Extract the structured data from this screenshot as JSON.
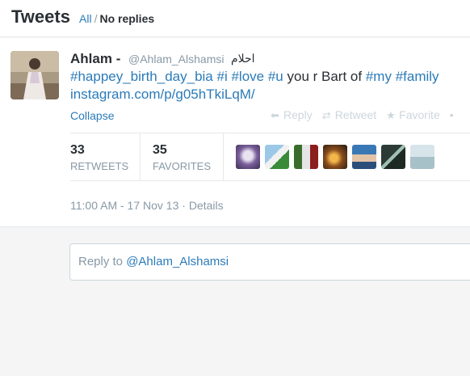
{
  "header": {
    "title": "Tweets",
    "filter_all": "All",
    "separator": "/",
    "filter_active": "No replies"
  },
  "tweet": {
    "name": "Ahlam",
    "name_dash": "-",
    "handle": "@Ahlam_Alshamsi",
    "arabic_name": "احلام",
    "text": {
      "tag1": "#happey_birth_day_bia",
      "tag2": "#i",
      "tag3": "#love",
      "tag4": "#u",
      "plain1": "you r Bart of",
      "tag5": "#my",
      "tag6": "#family",
      "link": "instagram.com/p/g05hTkiLqM/"
    },
    "collapse": "Collapse",
    "actions": {
      "reply": "Reply",
      "retweet": "Retweet",
      "favorite": "Favorite",
      "more": "•"
    },
    "stats": {
      "retweets_count": "33",
      "retweets_label": "RETWEETS",
      "favorites_count": "35",
      "favorites_label": "FAVORITES"
    },
    "timestamp": "11:00 AM - 17 Nov 13",
    "meta_sep": "·",
    "details": "Details"
  },
  "reply": {
    "prefix": "Reply to",
    "mention": "@Ahlam_Alshamsi"
  },
  "colors": {
    "link": "#2b7bb9",
    "muted": "#8899a6",
    "text": "#292f33"
  }
}
